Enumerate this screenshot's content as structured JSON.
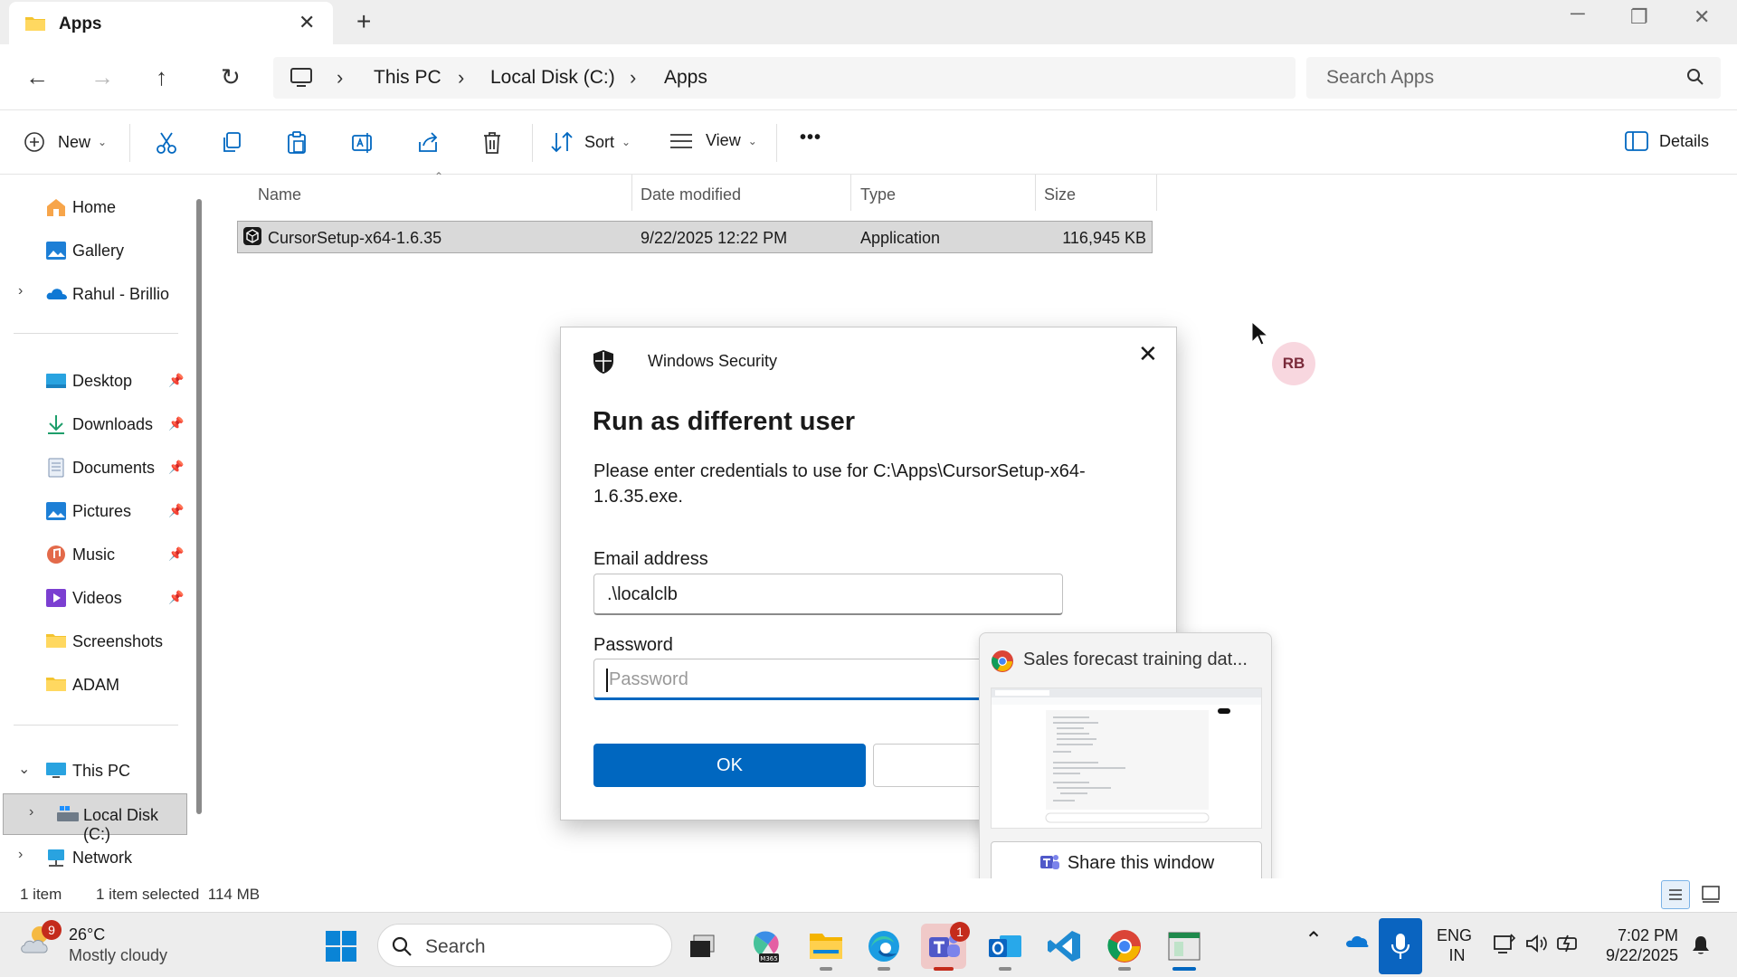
{
  "window": {
    "tab_title": "Apps",
    "new_tab": "+",
    "close_tab": "✕"
  },
  "nav": {
    "breadcrumb": [
      "This PC",
      "Local Disk (C:)",
      "Apps"
    ],
    "search_placeholder": "Search Apps"
  },
  "toolbar": {
    "new_label": "New",
    "sort_label": "Sort",
    "view_label": "View",
    "more_label": "•••",
    "details_label": "Details"
  },
  "sidebar": {
    "quick": [
      {
        "label": "Home",
        "icon": "home-icon"
      },
      {
        "label": "Gallery",
        "icon": "gallery-icon"
      },
      {
        "label": "Rahul - Brillio",
        "icon": "onedrive-icon"
      }
    ],
    "pinned": [
      {
        "label": "Desktop",
        "icon": "desktop-icon"
      },
      {
        "label": "Downloads",
        "icon": "downloads-icon"
      },
      {
        "label": "Documents",
        "icon": "documents-icon"
      },
      {
        "label": "Pictures",
        "icon": "pictures-icon"
      },
      {
        "label": "Music",
        "icon": "music-icon"
      },
      {
        "label": "Videos",
        "icon": "videos-icon"
      },
      {
        "label": "Screenshots",
        "icon": "folder-icon"
      },
      {
        "label": "ADAM",
        "icon": "folder-icon"
      }
    ],
    "devices": [
      {
        "label": "This PC",
        "icon": "pc-icon"
      },
      {
        "label": "Local Disk (C:)",
        "icon": "drive-icon"
      },
      {
        "label": "Network",
        "icon": "network-icon"
      }
    ]
  },
  "filelist": {
    "columns": [
      "Name",
      "Date modified",
      "Type",
      "Size"
    ],
    "rows": [
      {
        "name": "CursorSetup-x64-1.6.35",
        "date": "9/22/2025 12:22 PM",
        "type": "Application",
        "size": "116,945 KB"
      }
    ]
  },
  "dialog": {
    "app_name": "Windows Security",
    "title": "Run as different user",
    "description": "Please enter credentials to use for C:\\Apps\\CursorSetup-x64-1.6.35.exe.",
    "email_label": "Email address",
    "email_value": ".\\localclb",
    "password_label": "Password",
    "password_placeholder": "Password",
    "ok_label": "OK"
  },
  "thumbnail": {
    "title": "Sales forecast training dat...",
    "share_label": "Share this window"
  },
  "avatar": {
    "initials": "RB"
  },
  "status": {
    "count": "1 item",
    "selection": "1 item selected  114 MB"
  },
  "taskbar": {
    "weather_temp": "26°C",
    "weather_cond": "Mostly cloudy",
    "weather_badge": "9",
    "search_placeholder": "Search",
    "teams_badge": "1",
    "lang_1": "ENG",
    "lang_2": "IN",
    "time": "7:02 PM",
    "date": "9/22/2025"
  },
  "colors": {
    "accent": "#0067c0",
    "selected_row": "#d9d9d9",
    "badge": "#c42b1c"
  }
}
